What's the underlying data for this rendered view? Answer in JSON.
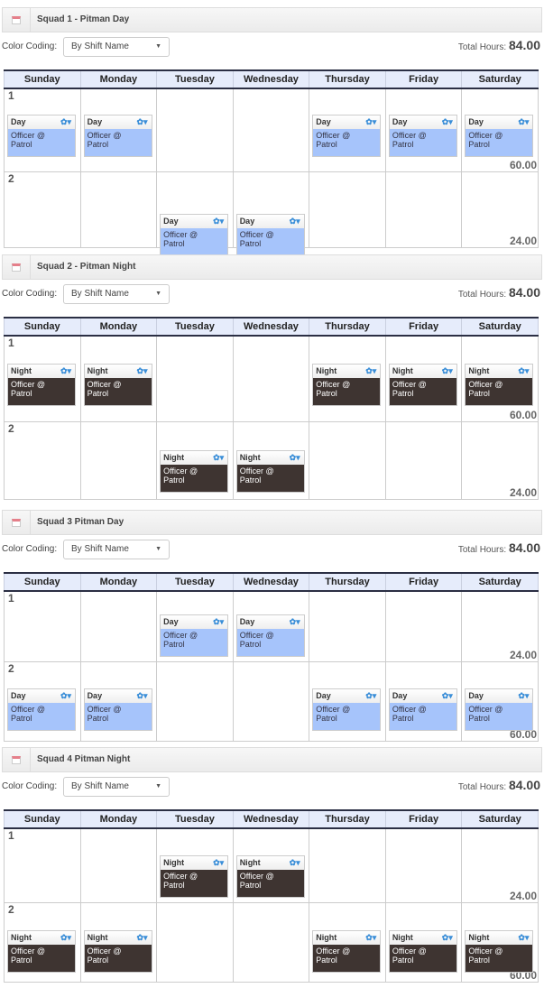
{
  "days": [
    "Sunday",
    "Monday",
    "Tuesday",
    "Wednesday",
    "Thursday",
    "Friday",
    "Saturday"
  ],
  "color_coding_label": "Color Coding:",
  "total_hours_label": "Total Hours:",
  "gear_glyph": "✿▾",
  "colors": {
    "day": "#a6c4fb",
    "night": "#3e3431",
    "header": "#e6ecfb"
  },
  "squads": [
    {
      "title": "Squad 1 - Pitman Day",
      "color_coding": "By Shift Name",
      "total_hours": "84.00",
      "rows": [
        {
          "num": "1",
          "hours": "60.00",
          "shifts": [
            {
              "name": "Day",
              "desc": "Officer @ Patrol"
            },
            {
              "name": "Day",
              "desc": "Officer @ Patrol"
            },
            null,
            null,
            {
              "name": "Day",
              "desc": "Officer @ Patrol"
            },
            {
              "name": "Day",
              "desc": "Officer @ Patrol"
            },
            {
              "name": "Day",
              "desc": "Officer @ Patrol"
            }
          ]
        },
        {
          "num": "2",
          "hours": "24.00",
          "shifts": [
            null,
            null,
            {
              "name": "Day",
              "desc": "Officer @ Patrol"
            },
            {
              "name": "Day",
              "desc": "Officer @ Patrol"
            },
            null,
            null,
            null
          ]
        }
      ]
    },
    {
      "title": "Squad 2 - Pitman Night",
      "color_coding": "By Shift Name",
      "total_hours": "84.00",
      "rows": [
        {
          "num": "1",
          "hours": "60.00",
          "shifts": [
            {
              "name": "Night",
              "desc": "Officer @ Patrol"
            },
            {
              "name": "Night",
              "desc": "Officer @ Patrol"
            },
            null,
            null,
            {
              "name": "Night",
              "desc": "Officer @ Patrol"
            },
            {
              "name": "Night",
              "desc": "Officer @ Patrol"
            },
            {
              "name": "Night",
              "desc": "Officer @ Patrol"
            }
          ]
        },
        {
          "num": "2",
          "hours": "24.00",
          "shifts": [
            null,
            null,
            {
              "name": "Night",
              "desc": "Officer @ Patrol"
            },
            {
              "name": "Night",
              "desc": "Officer @ Patrol"
            },
            null,
            null,
            null
          ]
        }
      ]
    },
    {
      "title": "Squad 3 Pitman Day",
      "color_coding": "By Shift Name",
      "total_hours": "84.00",
      "rows": [
        {
          "num": "1",
          "hours": "24.00",
          "shifts": [
            null,
            null,
            {
              "name": "Day",
              "desc": "Officer @ Patrol"
            },
            {
              "name": "Day",
              "desc": "Officer @ Patrol"
            },
            null,
            null,
            null
          ]
        },
        {
          "num": "2",
          "hours": "60.00",
          "shifts": [
            {
              "name": "Day",
              "desc": "Officer @ Patrol"
            },
            {
              "name": "Day",
              "desc": "Officer @ Patrol"
            },
            null,
            null,
            {
              "name": "Day",
              "desc": "Officer @ Patrol"
            },
            {
              "name": "Day",
              "desc": "Officer @ Patrol"
            },
            {
              "name": "Day",
              "desc": "Officer @ Patrol"
            }
          ]
        }
      ]
    },
    {
      "title": "Squad 4 Pitman Night",
      "color_coding": "By Shift Name",
      "total_hours": "84.00",
      "rows": [
        {
          "num": "1",
          "hours": "24.00",
          "shifts": [
            null,
            null,
            {
              "name": "Night",
              "desc": "Officer @ Patrol"
            },
            {
              "name": "Night",
              "desc": "Officer @ Patrol"
            },
            null,
            null,
            null
          ]
        },
        {
          "num": "2",
          "hours": "60.00",
          "shifts": [
            {
              "name": "Night",
              "desc": "Officer @ Patrol"
            },
            {
              "name": "Night",
              "desc": "Officer @ Patrol"
            },
            null,
            null,
            {
              "name": "Night",
              "desc": "Officer @ Patrol"
            },
            {
              "name": "Night",
              "desc": "Officer @ Patrol"
            },
            {
              "name": "Night",
              "desc": "Officer @ Patrol"
            }
          ]
        }
      ]
    }
  ]
}
